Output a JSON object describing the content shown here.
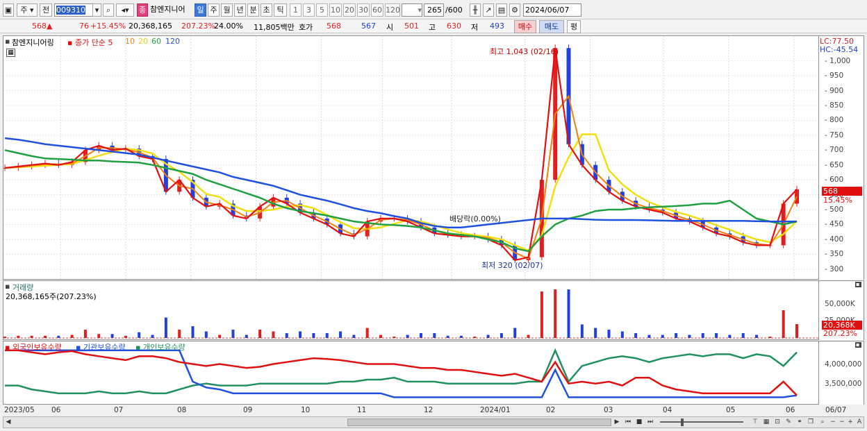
{
  "toolbar": {
    "market": "주",
    "compare": "전",
    "code": "009310",
    "stock_name": "참엔지니어",
    "name_badge": "종",
    "periods": [
      "일",
      "주",
      "월",
      "년",
      "분",
      "초",
      "틱"
    ],
    "minutes": [
      "1",
      "3",
      "5",
      "10",
      "20",
      "30",
      "60",
      "120"
    ],
    "count": "265",
    "count_total": "/600",
    "date": "2024/06/07"
  },
  "quote": {
    "price": "568",
    "arrow": "▲",
    "change": "76",
    "change_pct": "+15.45%",
    "volume": "20,368,165",
    "vol_ratio": "207.23%",
    "turnover": "24.00%",
    "amount": "11,805백만",
    "hoga_label": "호가",
    "ask": "568",
    "bid": "567",
    "open_label": "시",
    "open": "501",
    "high_label": "고",
    "high": "630",
    "low_label": "저",
    "low": "493",
    "buy": "매수",
    "sell": "매도",
    "eval": "평"
  },
  "price_pane": {
    "legend_name": "참엔지니어링",
    "legend_ma": "종가 단순",
    "ma": [
      "5",
      "10",
      "20",
      "60",
      "120"
    ],
    "lc": "LC:77.50",
    "hc": "HC:-45.54",
    "high_annot": "최고 1,043 (02/16)",
    "low_annot": "최저 320 (02/07)",
    "div_annot": "배당락(0.00%)",
    "y_ticks": [
      "1,000",
      "950",
      "900",
      "850",
      "800",
      "750",
      "700",
      "650",
      "600",
      "550",
      "500",
      "450",
      "400",
      "350",
      "300"
    ],
    "price_tag": "568",
    "pct_tag": "15.45%"
  },
  "volume_pane": {
    "title": "거래량",
    "value": "20,368,165주(207.23%)",
    "ticks": [
      "50,000K",
      "25,000K"
    ],
    "tag": "20,368K",
    "tag_pct": "207.23%"
  },
  "holding_pane": {
    "legends": [
      "외국인보유수량",
      "기관보유수량",
      "개인보유수량"
    ],
    "ticks": [
      "4,000,000",
      "3,500,000"
    ]
  },
  "x_labels": [
    "2023/05",
    "06",
    "07",
    "08",
    "09",
    "10",
    "11",
    "12",
    "2024/01",
    "02",
    "03",
    "04",
    "05",
    "06",
    "06/07"
  ],
  "colors": {
    "ma5": "#e01010",
    "ma10": "#f08010",
    "ma20": "#f0e010",
    "ma60": "#20a040",
    "ma120": "#2050e0",
    "up": "#e02020",
    "down": "#2040e0",
    "foreign": "#e01010",
    "inst": "#2050e0",
    "indiv": "#209060"
  },
  "chart_data": {
    "type": "candlestick",
    "title": "참엔지니어링",
    "ylim": [
      290,
      1060
    ],
    "high": 1043,
    "low": 320,
    "last": 568,
    "close": [
      640,
      645,
      650,
      655,
      650,
      660,
      700,
      715,
      700,
      705,
      680,
      670,
      560,
      600,
      540,
      510,
      520,
      480,
      470,
      510,
      540,
      520,
      490,
      470,
      450,
      420,
      410,
      460,
      470,
      470,
      460,
      440,
      420,
      415,
      410,
      410,
      400,
      380,
      330,
      340,
      600,
      1043,
      720,
      650,
      600,
      560,
      530,
      510,
      500,
      490,
      470,
      460,
      440,
      420,
      410,
      390,
      380,
      380,
      520,
      568
    ],
    "ma120": [
      740,
      735,
      728,
      720,
      715,
      710,
      705,
      700,
      695,
      690,
      685,
      675,
      665,
      655,
      645,
      635,
      625,
      610,
      600,
      590,
      580,
      565,
      550,
      540,
      530,
      518,
      505,
      495,
      488,
      478,
      470,
      455,
      445,
      440,
      440,
      445,
      450,
      455,
      460,
      465,
      470,
      470,
      470,
      468,
      466,
      465,
      465,
      465,
      464,
      463,
      462,
      462,
      462,
      462,
      462,
      462,
      461,
      460,
      460,
      460
    ],
    "ma60": [
      700,
      690,
      680,
      672,
      670,
      668,
      665,
      665,
      662,
      660,
      658,
      650,
      640,
      630,
      620,
      600,
      585,
      570,
      555,
      540,
      520,
      505,
      495,
      488,
      480,
      470,
      460,
      455,
      450,
      448,
      445,
      440,
      430,
      420,
      415,
      410,
      400,
      390,
      370,
      360,
      410,
      450,
      470,
      480,
      495,
      500,
      500,
      505,
      508,
      510,
      512,
      515,
      520,
      520,
      530,
      500,
      470,
      460,
      450,
      460
    ],
    "foreign": [
      4.4,
      4.4,
      4.35,
      4.3,
      4.35,
      4.38,
      4.3,
      4.25,
      4.2,
      4.15,
      4.25,
      4.25,
      4.2,
      4.1,
      4.05,
      4.0,
      4.05,
      4.0,
      3.95,
      3.98,
      4.05,
      4.1,
      4.15,
      4.2,
      4.18,
      4.15,
      4.1,
      4.05,
      4.05,
      4.05,
      4.0,
      3.95,
      3.95,
      3.9,
      3.9,
      3.85,
      3.8,
      3.75,
      3.8,
      3.7,
      3.6,
      4.1,
      3.55,
      3.6,
      3.55,
      3.6,
      3.5,
      3.7,
      3.7,
      3.5,
      3.4,
      3.35,
      3.3,
      3.3,
      3.3,
      3.3,
      3.3,
      3.3,
      3.6,
      3.25
    ],
    "inst": [
      4.4,
      4.4,
      4.4,
      4.4,
      4.4,
      4.4,
      4.4,
      4.4,
      4.4,
      4.4,
      4.4,
      4.4,
      4.4,
      4.4,
      3.6,
      3.45,
      3.4,
      3.3,
      3.3,
      3.3,
      3.3,
      3.3,
      3.3,
      3.3,
      3.3,
      3.3,
      3.3,
      3.3,
      3.3,
      3.2,
      3.2,
      3.2,
      3.2,
      3.2,
      3.2,
      3.2,
      3.2,
      3.2,
      3.2,
      3.2,
      3.2,
      3.9,
      3.2,
      3.2,
      3.2,
      3.2,
      3.2,
      3.2,
      3.2,
      3.2,
      3.2,
      3.2,
      3.2,
      3.2,
      3.2,
      3.2,
      3.2,
      3.2,
      3.2,
      3.25
    ],
    "indiv": [
      3.5,
      3.5,
      3.4,
      3.35,
      3.3,
      3.3,
      3.3,
      3.35,
      3.3,
      3.3,
      3.35,
      3.3,
      3.3,
      3.4,
      3.5,
      3.55,
      3.5,
      3.5,
      3.5,
      3.55,
      3.55,
      3.55,
      3.55,
      3.55,
      3.55,
      3.6,
      3.6,
      3.65,
      3.65,
      3.7,
      3.6,
      3.6,
      3.6,
      3.55,
      3.55,
      3.55,
      3.55,
      3.55,
      3.55,
      3.6,
      3.6,
      4.4,
      3.6,
      4.0,
      4.1,
      4.2,
      4.25,
      4.2,
      4.1,
      4.2,
      4.25,
      4.3,
      4.25,
      4.3,
      4.3,
      4.2,
      4.3,
      4.25,
      4.0,
      4.35
    ]
  }
}
